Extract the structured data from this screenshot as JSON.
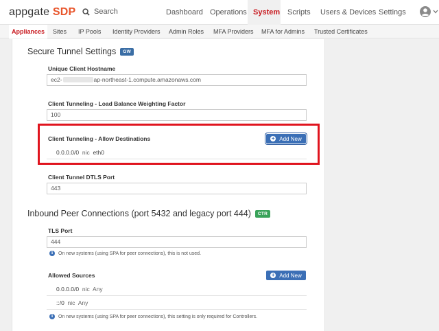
{
  "header": {
    "logo_main": "appgate",
    "logo_accent": "SDP",
    "search_label": "Search",
    "nav": [
      "Dashboard",
      "Operations",
      "System",
      "Scripts",
      "Users & Devices",
      "Settings"
    ],
    "active_nav": "System"
  },
  "subnav": {
    "items": [
      "Appliances",
      "Sites",
      "IP Pools",
      "Identity Providers",
      "Admin Roles",
      "MFA Providers",
      "MFA for Admins",
      "Trusted Certificates"
    ],
    "active": "Appliances"
  },
  "secure_tunnel": {
    "title": "Secure Tunnel Settings",
    "badge": "GW",
    "hostname_label": "Unique Client Hostname",
    "hostname_prefix": "ec2-",
    "hostname_suffix": "ap-northeast-1.compute.amazonaws.com",
    "lb_label": "Client Tunneling - Load Balance Weighting Factor",
    "lb_value": "100",
    "allow_label": "Client Tunneling - Allow Destinations",
    "add_new": "Add New",
    "destinations": [
      {
        "cidr": "0.0.0.0/0",
        "type": "nic",
        "value": "eth0"
      }
    ],
    "dtls_label": "Client Tunnel DTLS Port",
    "dtls_value": "443"
  },
  "inbound": {
    "title": "Inbound Peer Connections (port 5432 and legacy port 444)",
    "badge": "CTR",
    "tls_label": "TLS Port",
    "tls_value": "444",
    "tls_note": "On new systems (using SPA for peer connections), this is not used.",
    "sources_label": "Allowed Sources",
    "add_new": "Add New",
    "sources": [
      {
        "cidr": "0.0.0.0/0",
        "type": "nic",
        "value": "Any"
      },
      {
        "cidr": "::/0",
        "type": "nic",
        "value": "Any"
      }
    ],
    "sources_note": "On new systems (using SPA for peer connections), this setting is only required for Controllers."
  },
  "colors": {
    "accent": "#c8181e",
    "logo_accent": "#e8552b",
    "button": "#3b6fb6",
    "highlight": "#e0141e"
  }
}
